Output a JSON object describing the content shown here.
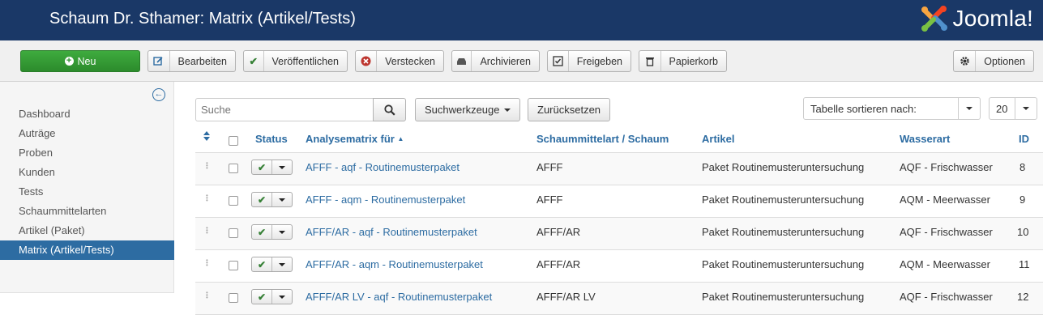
{
  "header": {
    "title": "Schaum Dr. Sthamer: Matrix (Artikel/Tests)",
    "logo_text": "Joomla!"
  },
  "toolbar": {
    "new": "Neu",
    "edit": "Bearbeiten",
    "publish": "Veröffentlichen",
    "hide": "Verstecken",
    "archive": "Archivieren",
    "release": "Freigeben",
    "trash": "Papierkorb",
    "options": "Optionen"
  },
  "sidebar": {
    "items": [
      {
        "label": "Dashboard",
        "active": false
      },
      {
        "label": "Auträge",
        "active": false
      },
      {
        "label": "Proben",
        "active": false
      },
      {
        "label": "Kunden",
        "active": false
      },
      {
        "label": "Tests",
        "active": false
      },
      {
        "label": "Schaummittelarten",
        "active": false
      },
      {
        "label": "Artikel (Paket)",
        "active": false
      },
      {
        "label": "Matrix (Artikel/Tests)",
        "active": true
      }
    ]
  },
  "filters": {
    "search_placeholder": "Suche",
    "search_tools": "Suchwerkzeuge",
    "reset": "Zurücksetzen",
    "sort_label": "Tabelle sortieren nach:",
    "limit": "20"
  },
  "table": {
    "headers": {
      "status": "Status",
      "matrix": "Analysematrix für",
      "foam": "Schaummittelart / Schaum",
      "article": "Artikel",
      "water": "Wasserart",
      "id": "ID"
    },
    "rows": [
      {
        "matrix": "AFFF - aqf - Routinemusterpaket",
        "foam": "AFFF",
        "article": "Paket Routinemusteruntersuchung",
        "water": "AQF - Frischwasser",
        "id": "8"
      },
      {
        "matrix": "AFFF - aqm - Routinemusterpaket",
        "foam": "AFFF",
        "article": "Paket Routinemusteruntersuchung",
        "water": "AQM - Meerwasser",
        "id": "9"
      },
      {
        "matrix": "AFFF/AR - aqf - Routinemusterpaket",
        "foam": "AFFF/AR",
        "article": "Paket Routinemusteruntersuchung",
        "water": "AQF - Frischwasser",
        "id": "10"
      },
      {
        "matrix": "AFFF/AR - aqm - Routinemusterpaket",
        "foam": "AFFF/AR",
        "article": "Paket Routinemusteruntersuchung",
        "water": "AQM - Meerwasser",
        "id": "11"
      },
      {
        "matrix": "AFFF/AR LV - aqf - Routinemusterpaket",
        "foam": "AFFF/AR LV",
        "article": "Paket Routinemusteruntersuchung",
        "water": "AQF - Frischwasser",
        "id": "12"
      }
    ]
  },
  "colors": {
    "header_bg": "#1a3867",
    "accent": "#2d6ca2",
    "new_button": "#2f932f"
  }
}
